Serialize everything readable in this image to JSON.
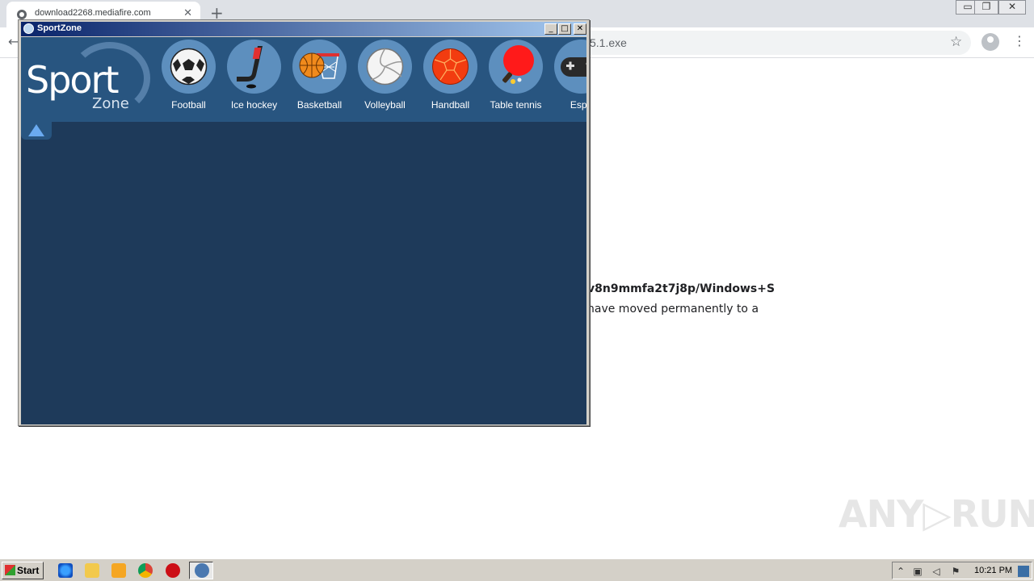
{
  "browser": {
    "tab_title": "download2268.mediafire.com",
    "tab_close": "✕",
    "new_tab": "+",
    "address_visible": "5.1.exe",
    "window_minimize": "▭",
    "window_restore": "❐",
    "window_close": "✕"
  },
  "page": {
    "url_fragment": "v8n9mmfa2t7j8p/Windows+S",
    "message_fragment": "have moved permanently to a"
  },
  "watermark": "ANY▷RUN",
  "sportzone": {
    "title": "SportZone",
    "logo_main": "Sport",
    "logo_sub": "Zone",
    "buttons": {
      "minimize": "_",
      "maximize": "□",
      "close": "✕"
    },
    "sports": [
      {
        "label": "Football",
        "icon": "soccer-ball-icon"
      },
      {
        "label": "Ice hockey",
        "icon": "hockey-stick-icon"
      },
      {
        "label": "Basketball",
        "icon": "basketball-icon"
      },
      {
        "label": "Volleyball",
        "icon": "volleyball-icon"
      },
      {
        "label": "Handball",
        "icon": "handball-icon"
      },
      {
        "label": "Table tennis",
        "icon": "ping-pong-paddle-icon"
      },
      {
        "label": "Espo",
        "icon": "gamepad-icon"
      }
    ]
  },
  "taskbar": {
    "start_label": "Start",
    "clock": "10:21 PM"
  },
  "colors": {
    "sz_body": "#1e3a5a",
    "sz_header": "#285580",
    "sport_circle": "#5d8fbe"
  }
}
